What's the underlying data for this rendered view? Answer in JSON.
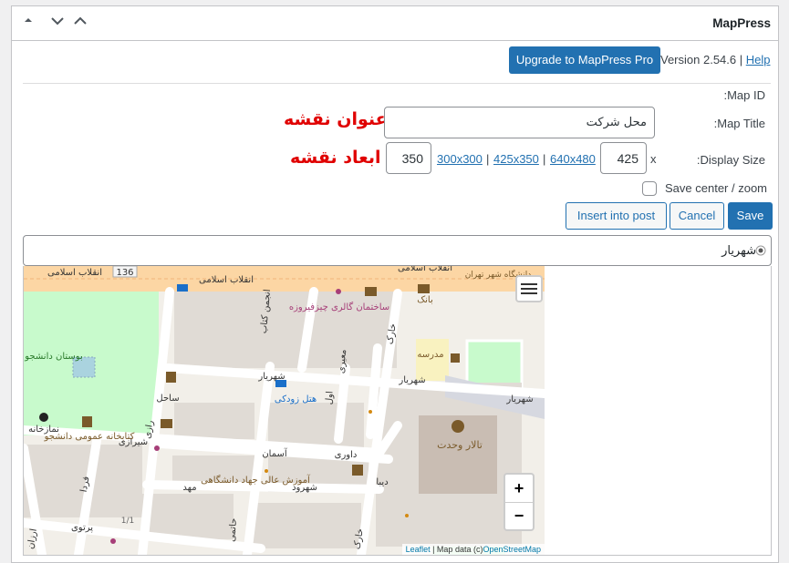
{
  "panel": {
    "title": "MapPress"
  },
  "top": {
    "upgrade_label": "Upgrade to MapPress Pro",
    "version_text": "Version 2.54.6 |",
    "help_label": "Help"
  },
  "form": {
    "map_id_label": ":Map ID",
    "map_title_label": ":Map Title",
    "map_title_value": "محل شرکت",
    "map_title_annotation": "عنوان نقشه",
    "display_size_label": ":Display Size",
    "width_value": "425",
    "x_label": "x",
    "height_value": "350",
    "size_presets": [
      "640x480",
      "425x350",
      "300x300"
    ],
    "pipe": "|",
    "size_annotation": "ابعاد نقشه",
    "save_center_label": "Save center / zoom",
    "save_center_checked": false
  },
  "actions": {
    "insert_label": "Insert into post",
    "cancel_label": "Cancel",
    "save_label": "Save"
  },
  "poi_list": {
    "item_label": "شهریار"
  },
  "map": {
    "streets": {
      "enghelab1": "انقلاب اسلامی",
      "enghelab2": "انقلاب اسلامی",
      "enghelab3": "انقلاب اسلامی",
      "road_num": "136",
      "shahriar1": "شهریار",
      "shahriar2": "شهریار",
      "shahriar3": "شهریار",
      "shiraz": "شیرازی",
      "sahel": "ساحل",
      "asman": "آسمان",
      "davari": "داوری",
      "shahrood": "شهرود",
      "mahd": "مهد",
      "dibaye": "دیبا",
      "partovi": "پرتوی",
      "farda": "فردا",
      "arzanan": "ارزان",
      "khark": "خارک",
      "khark2": "خارک",
      "moayyeri": "معیری",
      "anjoman": "انجمن کتاب",
      "razi": "رازی",
      "aval": "اول",
      "hatami": "حاتمی",
      "univ": "دانشگاه شهر تهران"
    },
    "pois": {
      "park_name": "بوستان دانشجو",
      "gallery": "ساختمان گالری چیزفیروزه",
      "bank": "بانک",
      "school": "مدرسه",
      "hotel": "هتل زودکی",
      "hall": "تالار وحدت",
      "library": "کتابخانه عمومی دانشجو",
      "education": "آموزش عالی جهاد دانشگاهی",
      "mosque": "نمازخانه",
      "page_ind": "1/1"
    },
    "zoom_in": "+",
    "zoom_out": "−",
    "attribution_leaflet": "Leaflet",
    "attribution_sep": " | Map data (c)",
    "attribution_osm": "OpenStreetMap"
  },
  "colors": {
    "accent": "#2271b1",
    "annotation": "#e00000",
    "park": "#c8facc",
    "arterial": "#fcd6a4",
    "building": "#d9d0c9"
  },
  "icons": [
    "chevron-up-icon",
    "chevron-down-icon",
    "chevron-up-icon",
    "radio-icon",
    "layers-icon",
    "book-icon",
    "mosque-icon",
    "bank-icon"
  ]
}
